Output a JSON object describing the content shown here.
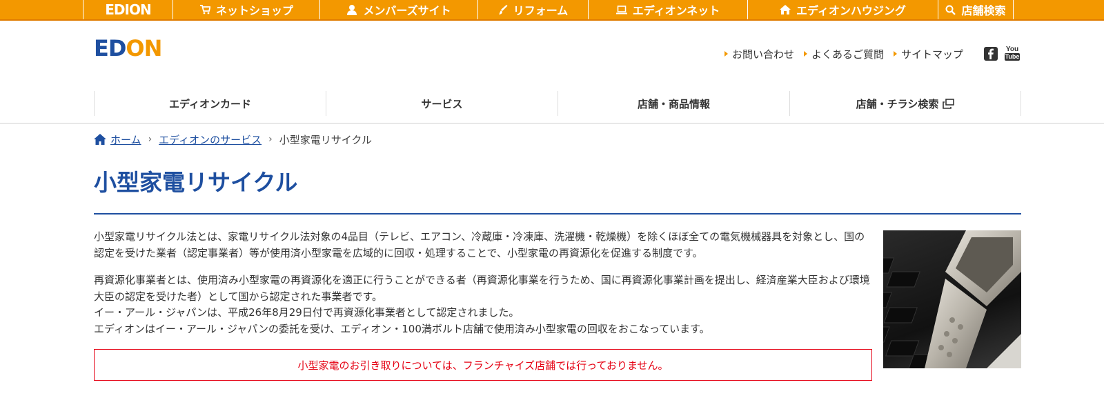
{
  "topbar": {
    "logo": "EDION",
    "items": [
      {
        "label": "ネットショップ",
        "icon": "cart-icon"
      },
      {
        "label": "メンバーズサイト",
        "icon": "person-icon"
      },
      {
        "label": "リフォーム",
        "icon": "brush-icon"
      },
      {
        "label": "エディオンネット",
        "icon": "laptop-icon"
      },
      {
        "label": "エディオンハウジング",
        "icon": "house-icon"
      },
      {
        "label": "店舗検索",
        "icon": "search-icon"
      }
    ]
  },
  "header": {
    "logo_ed": "ED",
    "logo_on": "ON",
    "util_links": [
      {
        "label": "お問い合わせ"
      },
      {
        "label": "よくあるご質問"
      },
      {
        "label": "サイトマップ"
      }
    ],
    "sns": [
      "facebook-icon",
      "youtube-icon"
    ],
    "youtube_top": "You",
    "youtube_bottom": "Tube"
  },
  "gnav": {
    "items": [
      {
        "label": "エディオンカード"
      },
      {
        "label": "サービス"
      },
      {
        "label": "店舗・商品情報"
      },
      {
        "label": "店舗・チラシ検索",
        "icon": "external-window-icon"
      }
    ]
  },
  "breadcrumb": {
    "home": "ホーム",
    "parent": "エディオンのサービス",
    "current": "小型家電リサイクル",
    "separator": "›"
  },
  "page": {
    "title": "小型家電リサイクル",
    "paragraph1": "小型家電リサイクル法とは、家電リサイクル法対象の4品目（テレビ、エアコン、冷蔵庫・冷凍庫、洗濯機・乾燥機）を除くほぼ全ての電気機械器具を対象とし、国の認定を受けた業者（認定事業者）等が使用済小型家電を広域的に回収・処理することで、小型家電の再資源化を促進する制度です。",
    "paragraph2": "再資源化事業者とは、使用済み小型家電の再資源化を適正に行うことができる者（再資源化事業を行うため、国に再資源化事業計画を提出し、経済産業大臣および環境大臣の認定を受けた者）として国から認定された事業者です。",
    "paragraph3": "イー・アール・ジャパンは、平成26年8月29日付で再資源化事業者として認定されました。",
    "paragraph4": "エディオンはイー・アール・ジャパンの委託を受け、エディオン・100満ボルト店舗で使用済み小型家電の回収をおこなっています。",
    "notice": "小型家電のお引き取りについては、フランチャイズ店舗では行っておりません。"
  },
  "colors": {
    "orange": "#f39800",
    "blue": "#1e4fa0",
    "red": "#e50012"
  }
}
